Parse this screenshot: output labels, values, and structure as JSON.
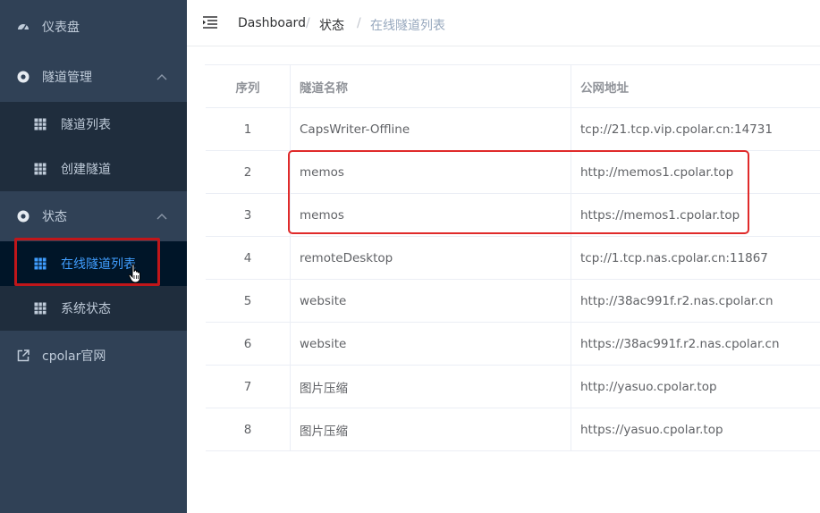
{
  "sidebar": {
    "dashboard": {
      "label": "仪表盘",
      "icon": "dashboard-icon"
    },
    "tunnel_mgmt": {
      "label": "隧道管理",
      "icon": "gear-icon",
      "items": [
        {
          "label": "隧道列表",
          "icon": "table-icon"
        },
        {
          "label": "创建隧道",
          "icon": "table-icon"
        }
      ]
    },
    "status": {
      "label": "状态",
      "icon": "gear-icon",
      "items": [
        {
          "label": "在线隧道列表",
          "icon": "table-icon",
          "active": true
        },
        {
          "label": "系统状态",
          "icon": "table-icon"
        }
      ]
    },
    "external": {
      "label": "cpolar官网",
      "icon": "external-link-icon"
    }
  },
  "breadcrumb": {
    "dashboard": "Dashboard",
    "sep": "/",
    "status": "状态",
    "current": "在线隧道列表"
  },
  "table": {
    "headers": [
      "序列",
      "隧道名称",
      "公网地址"
    ],
    "rows": [
      {
        "index": "1",
        "name": "CapsWriter-Offline",
        "url": "tcp://21.tcp.vip.cpolar.cn:14731"
      },
      {
        "index": "2",
        "name": "memos",
        "url": "http://memos1.cpolar.top"
      },
      {
        "index": "3",
        "name": "memos",
        "url": "https://memos1.cpolar.top"
      },
      {
        "index": "4",
        "name": "remoteDesktop",
        "url": "tcp://1.tcp.nas.cpolar.cn:11867"
      },
      {
        "index": "5",
        "name": "website",
        "url": "http://38ac991f.r2.nas.cpolar.cn"
      },
      {
        "index": "6",
        "name": "website",
        "url": "https://38ac991f.r2.nas.cpolar.cn"
      },
      {
        "index": "7",
        "name": "图片压缩",
        "url": "http://yasuo.cpolar.top"
      },
      {
        "index": "8",
        "name": "图片压缩",
        "url": "https://yasuo.cpolar.top"
      }
    ]
  },
  "colors": {
    "sidebar_bg": "#304156",
    "submenu_bg": "#1f2d3d",
    "active_text": "#409eff",
    "annotation_red": "#e02a2a"
  }
}
